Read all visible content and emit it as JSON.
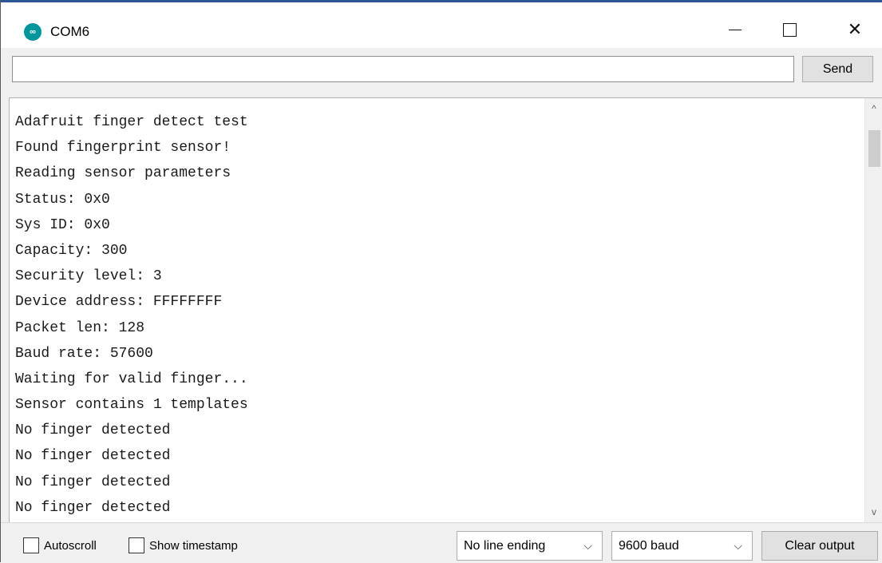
{
  "window": {
    "title": "COM6",
    "icon_name": "arduino-icon",
    "icon_glyph": "∞",
    "controls": {
      "minimize": "minimize-icon",
      "maximize": "maximize-icon",
      "close": "✕"
    }
  },
  "send_bar": {
    "input_value": "",
    "send_label": "Send"
  },
  "output": {
    "lines": [
      "Adafruit finger detect test",
      "Found fingerprint sensor!",
      "Reading sensor parameters",
      "Status: 0x0",
      "Sys ID: 0x0",
      "Capacity: 300",
      "Security level: 3",
      "Device address: FFFFFFFF",
      "Packet len: 128",
      "Baud rate: 57600",
      "Waiting for valid finger...",
      "Sensor contains 1 templates",
      "No finger detected",
      "No finger detected",
      "No finger detected",
      "No finger detected"
    ],
    "scroll_up": "^",
    "scroll_down": "v"
  },
  "bottom_bar": {
    "autoscroll_label": "Autoscroll",
    "autoscroll_checked": false,
    "timestamp_label": "Show timestamp",
    "timestamp_checked": false,
    "line_ending_selected": "No line ending",
    "baud_selected": "9600 baud",
    "chevron": "⌵",
    "clear_label": "Clear output"
  }
}
